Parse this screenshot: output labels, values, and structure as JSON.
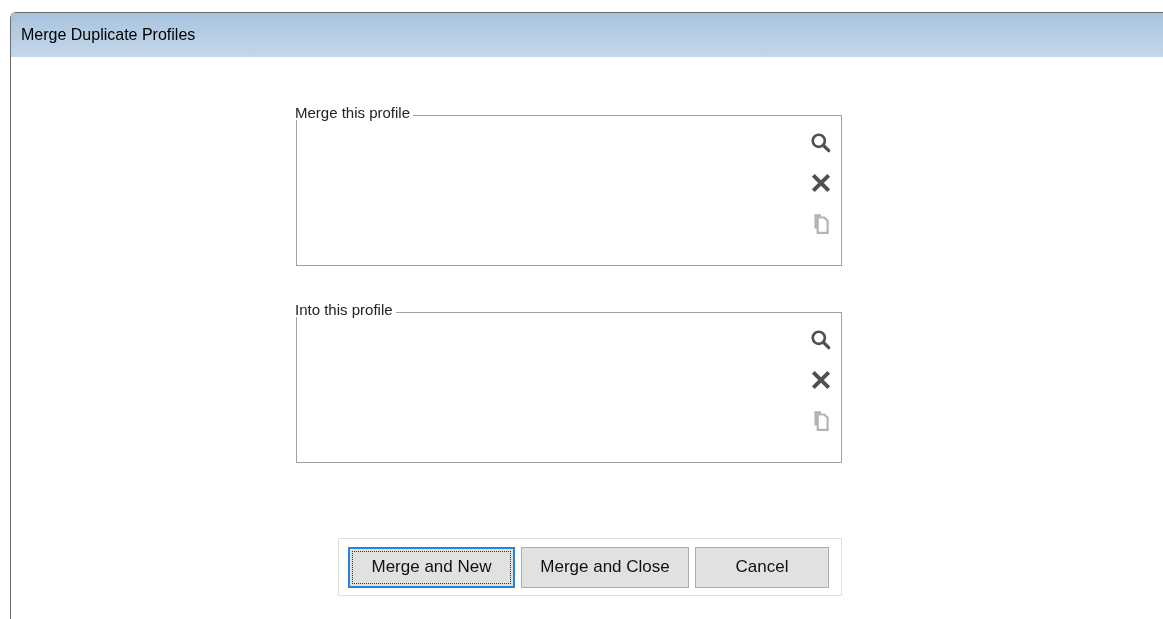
{
  "window": {
    "title": "Merge Duplicate Profiles"
  },
  "groups": [
    {
      "label": "Merge this profile",
      "actions": [
        {
          "kind": "search",
          "disabled": false
        },
        {
          "kind": "clear",
          "disabled": false
        },
        {
          "kind": "copy",
          "disabled": true
        }
      ]
    },
    {
      "label": "Into this profile",
      "actions": [
        {
          "kind": "search",
          "disabled": false
        },
        {
          "kind": "clear",
          "disabled": false
        },
        {
          "kind": "copy",
          "disabled": true
        }
      ]
    }
  ],
  "buttons": [
    {
      "label": "Merge and New",
      "focused": true
    },
    {
      "label": "Merge and Close",
      "focused": false
    },
    {
      "label": "Cancel",
      "focused": false
    }
  ]
}
